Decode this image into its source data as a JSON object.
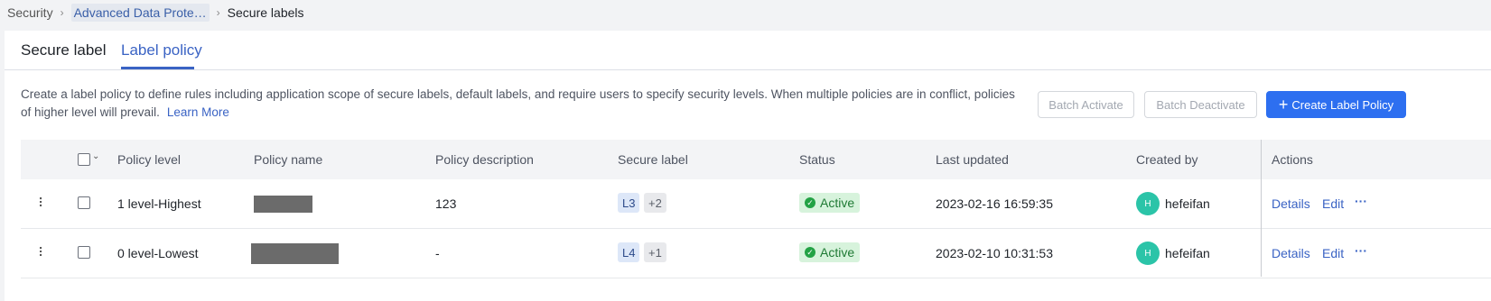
{
  "breadcrumb": {
    "root": "Security",
    "parent": "Advanced Data Prote…",
    "current": "Secure labels"
  },
  "tabs": [
    {
      "label": "Secure label",
      "active": false
    },
    {
      "label": "Label policy",
      "active": true
    }
  ],
  "description": {
    "text": "Create a label policy to define rules including application scope of secure labels, default labels, and require users to specify security levels. When multiple policies are in conflict, policies of higher level will prevail.",
    "learn_more": "Learn More"
  },
  "toolbar": {
    "batch_activate": "Batch Activate",
    "batch_deactivate": "Batch Deactivate",
    "create": "Create Label Policy"
  },
  "table": {
    "headers": {
      "level": "Policy level",
      "name": "Policy name",
      "description": "Policy description",
      "label": "Secure label",
      "status": "Status",
      "updated": "Last updated",
      "created_by": "Created by",
      "actions": "Actions"
    },
    "rows": [
      {
        "level": "1 level-Highest",
        "description": "123",
        "label": "L3",
        "label_more": "+2",
        "status": "Active",
        "updated": "2023-02-16 16:59:35",
        "avatar": "H",
        "created_by": "hefeifan",
        "details": "Details",
        "edit": "Edit",
        "more": "···"
      },
      {
        "level": "0 level-Lowest",
        "description": "-",
        "label": "L4",
        "label_more": "+1",
        "status": "Active",
        "updated": "2023-02-10 10:31:53",
        "avatar": "H",
        "created_by": "hefeifan",
        "details": "Details",
        "edit": "Edit",
        "more": "···"
      }
    ]
  },
  "colors": {
    "accent": "#2d6ff0",
    "link": "#3a63c4",
    "active_badge_bg": "#d7f3dc",
    "active_badge_text": "#1f7a34",
    "avatar": "#2bc4a8"
  }
}
